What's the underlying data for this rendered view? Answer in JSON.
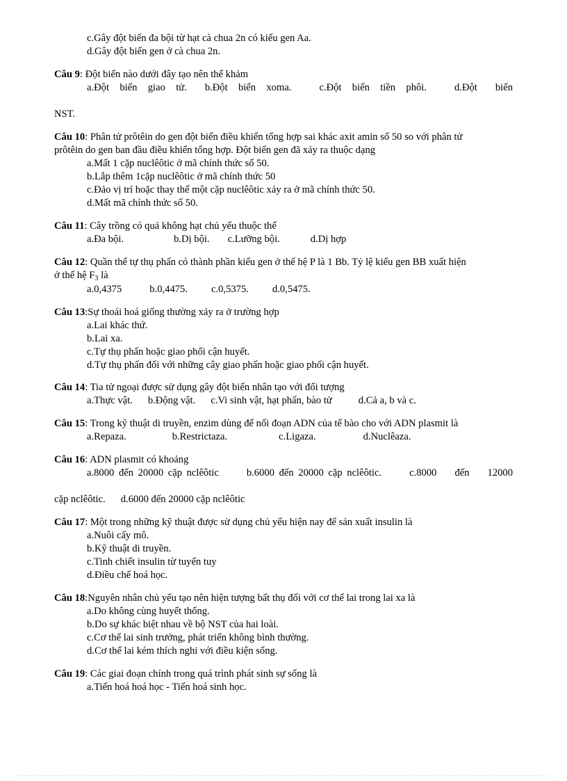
{
  "document": {
    "language": "vi",
    "page_background": "#ffffff",
    "text_color": "#000000",
    "footer_rule_color": "#d8d8d8"
  },
  "orphan_options": [
    "c.Gây đột biến đa bội từ hạt cà chua 2n có kiểu gen Aa.",
    "d.Gây đột biến gen ở cà chua 2n."
  ],
  "questions": [
    {
      "label": "Câu 9",
      "separator": ":",
      "stem": "Đột biến nào dưới đây tạo nên thể khảm",
      "layout": "inline-row",
      "options_inline": [
        "a.Đột biến giao tử.",
        "b.Đột biến xoma.",
        "c.Đột biến tiền phôi.",
        "d.Đột",
        "biến"
      ],
      "continuation": "NST."
    },
    {
      "label": "Câu 10",
      "separator": ":",
      "stem": "Phân tử prôtêin do gen đột biến điều khiển tổng hợp sai khác axit amin số 50 so với phân tử",
      "stem_continuation": "prôtêin do gen ban đầu điều khiển tổng hợp. Đột biến gen đã xảy ra thuộc dạng",
      "layout": "stacked",
      "options": [
        "a.Mất 1 cặp nuclêôtic ở mã chính thức số 50.",
        "b.Lắp thêm  1cặp nuclêôtic  ở mã chính  thức 50",
        "c.Đảo vị trí hoặc thay thế một cặp nuclêôtic  xảy ra ở mã chính  thức 50.",
        "d.Mất mã chính  thức số 50."
      ]
    },
    {
      "label": "Câu 11",
      "separator": ":",
      "stem": "Cây trồng có quả không hạt chủ yếu thuộc thể",
      "layout": "inline-row",
      "options_inline": [
        "a.Đa bội.",
        "b.Dị bội.",
        "c.Lưỡng bội.",
        "d.Dị hợp"
      ]
    },
    {
      "label": "Câu 12",
      "separator": ":",
      "stem": "Quần thể tự thụ phấn có thành phần kiểu gen ở thế hệ P là 1 Bb. Tỷ lệ kiểu gen BB xuất hiện",
      "stem_continuation_prefix": "ở thế hệ F",
      "stem_continuation_sub": "3",
      "stem_continuation_suffix": " là",
      "layout": "inline-row",
      "options_inline": [
        "a.0,4375",
        "b.0,4475.",
        "c.0,5375.",
        "d.0,5475."
      ]
    },
    {
      "label": "Câu 13",
      "separator": ":",
      "stem": "Sự thoái hoá giống  thường xảy ra ở trường hợp",
      "layout": "stacked",
      "options": [
        "a.Lai khác thứ.",
        "b.Lai xa.",
        "c.Tự thụ phấn hoặc giao phối cận huyết.",
        "d.Tự thụ phấn đối với những  cây giao phấn hoặc giao phối cận huyết."
      ]
    },
    {
      "label": "Câu 14",
      "separator": ":",
      "stem": "Tia tử ngoại được sử dụng gây đột biến nhân tạo với đối tượng",
      "layout": "inline-row",
      "options_inline": [
        "a.Thực vật.",
        "b.Động vật.",
        "c.Vi sinh vật, hạt phấn, bào tử",
        "d.Cả a, b và c."
      ]
    },
    {
      "label": "Câu 15",
      "separator": ":",
      "stem": "Trong kỹ thuật di truyền, enzim dùng để nối đoạn ADN của tế bào cho với  ADN plasmit  là",
      "layout": "inline-row",
      "options_inline": [
        "a.Repaza.",
        "b.Restrictaza.",
        "c.Ligaza.",
        "d.Nuclêaza."
      ]
    },
    {
      "label": "Câu 16",
      "separator": ":",
      "stem": "ADN plasmit  có khoảng",
      "layout": "inline-row",
      "options_inline": [
        "a.8000 đến 20000 cặp nclêôtic",
        "b.6000 đến 20000 cặp nclêôtic.",
        "c.8000",
        "đến",
        "12000"
      ],
      "options_continuation": [
        "cặp nclêôtic.",
        "d.6000 đến 20000 cặp nclêôtic"
      ]
    },
    {
      "label": "Câu 17",
      "separator": ":",
      "stem": "Một trong những kỹ thuật được sử dụng chủ yếu hiện nay để sản xuất insulin  là",
      "layout": "stacked",
      "options": [
        "a.Nuôi cấy mô.",
        "b.Kỹ thuật di truyền.",
        "c.Tinh chiết insulin  từ tuyến tuy",
        "d.Điều chế hoá học."
      ]
    },
    {
      "label": "Câu 18",
      "separator": ":",
      "stem": "Nguyên nhân chủ yếu tạo nên hiện tượng bất thụ đối với cơ thể lai trong lai xa là",
      "layout": "stacked",
      "no_space_after_label": true,
      "options": [
        "a.Do không cùng huyết thống.",
        "b.Do sự khác biệt nhau về bộ NST của hai loài.",
        "c.Cơ thể lai sinh trưởng, phát triển không bình thường.",
        "d.Cơ thể lai kém thích nghi với điều kiện sống."
      ]
    },
    {
      "label": "Câu 19",
      "separator": ":",
      "stem": "Các giai đoạn chính trong quá trình phát sinh sự sống là",
      "layout": "stacked",
      "options": [
        "a.Tiến hoá hoá học - Tiến hoá sinh học."
      ]
    }
  ]
}
